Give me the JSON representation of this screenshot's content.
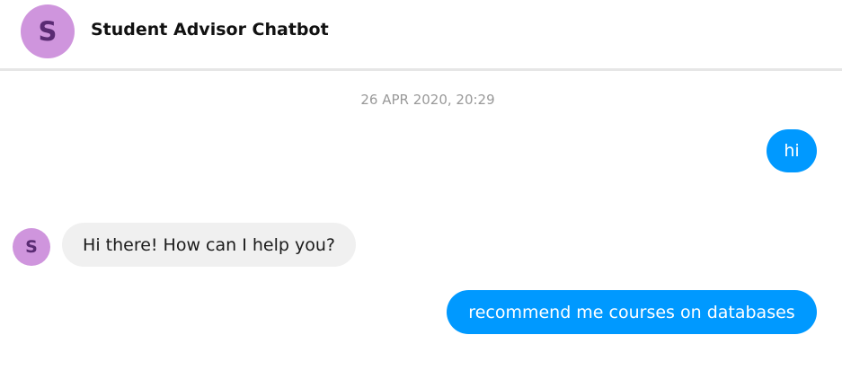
{
  "header": {
    "avatar_initial": "S",
    "title": "Student Advisor Chatbot"
  },
  "conversation": {
    "timestamp": "26 APR 2020, 20:29",
    "messages": [
      {
        "sender": "user",
        "text": "hi"
      },
      {
        "sender": "bot",
        "avatar_initial": "S",
        "text": "Hi there! How can I help you?"
      },
      {
        "sender": "user",
        "text": "recommend me courses on databases"
      }
    ]
  },
  "colors": {
    "user_bubble": "#0099ff",
    "bot_bubble": "#f0f0f0",
    "avatar_bg": "#cf95dd",
    "avatar_text": "#5a2b73"
  }
}
